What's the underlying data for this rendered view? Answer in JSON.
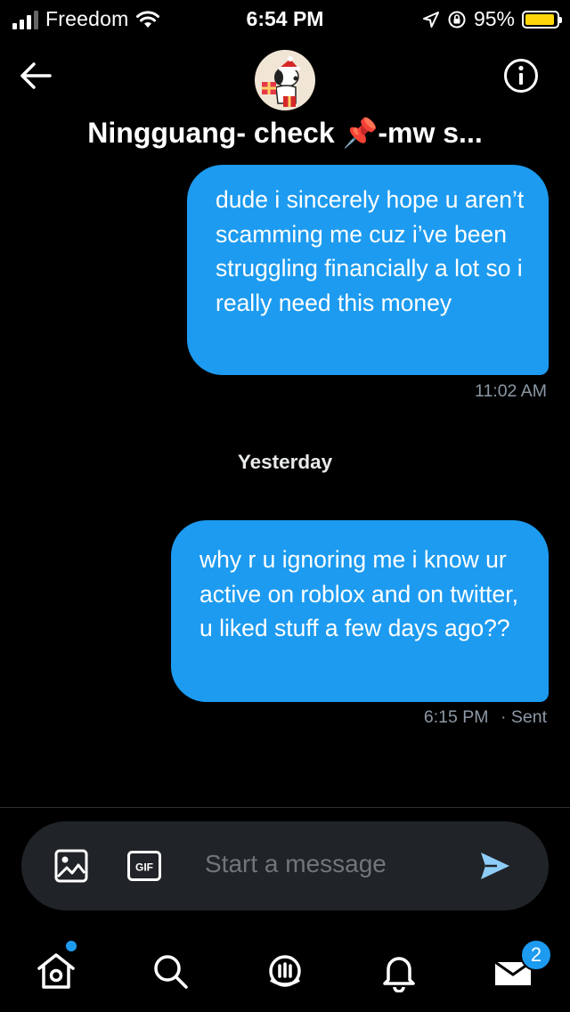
{
  "status_bar": {
    "carrier": "Freedom",
    "time": "6:54 PM",
    "battery": "95%",
    "battery_level": 0.95,
    "battery_color": "#ffd60a"
  },
  "header": {
    "title": "Ningguang- check 📌-mw s...",
    "back_icon": "arrow-left-icon",
    "info_icon": "info-icon"
  },
  "messages": [
    {
      "text": "dude i sincerely hope u aren’t scamming me cuz i’ve been struggling financially a lot so i really need this money",
      "time": "11:02 AM",
      "sent": true
    },
    {
      "text": "why r u ignoring me i know ur active on roblox and on twitter, u liked stuff a few days ago??",
      "time": "6:15 PM",
      "status": "· Sent",
      "sent": true
    }
  ],
  "day_separator": "Yesterday",
  "composer": {
    "placeholder": "Start a message",
    "image_icon": "image-icon",
    "gif_icon": "gif-icon",
    "gif_label": "GIF",
    "send_icon": "send-icon"
  },
  "tabs": [
    {
      "name": "home",
      "icon": "home-icon",
      "has_dot": true
    },
    {
      "name": "search",
      "icon": "search-icon"
    },
    {
      "name": "spaces",
      "icon": "spaces-icon"
    },
    {
      "name": "notifications",
      "icon": "bell-icon"
    },
    {
      "name": "messages",
      "icon": "mail-icon",
      "badge": "2"
    }
  ],
  "colors": {
    "accent": "#1d9bf0",
    "background": "#000000",
    "composer_bg": "#202327",
    "muted_text": "#8b98a5"
  }
}
